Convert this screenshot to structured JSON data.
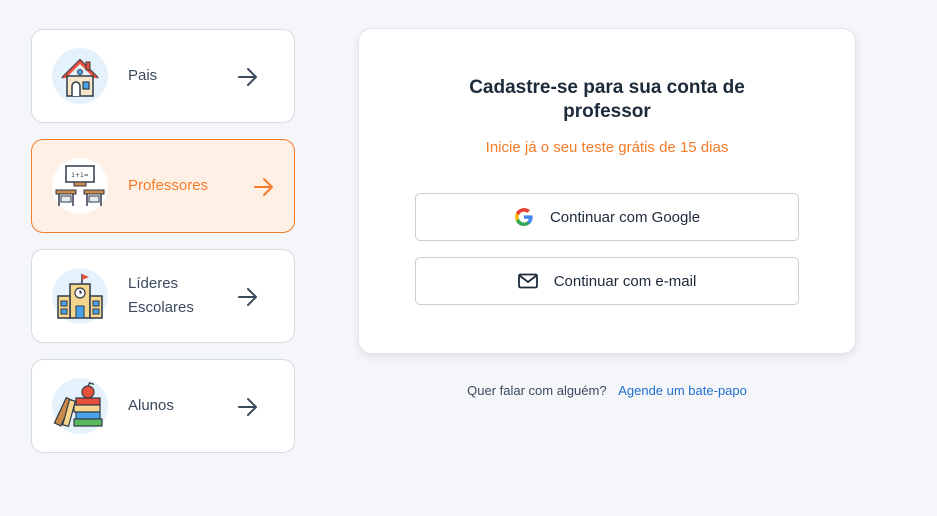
{
  "roles": [
    {
      "label": "Pais",
      "icon": "house-icon",
      "active": false
    },
    {
      "label": "Professores",
      "icon": "classroom-icon",
      "active": true
    },
    {
      "label": "Líderes Escolares",
      "icon": "school-building-icon",
      "active": false
    },
    {
      "label": "Alunos",
      "icon": "books-apple-icon",
      "active": false
    }
  ],
  "signup": {
    "title": "Cadastre-se para sua conta de professor",
    "subtitle": "Inicie já o seu teste grátis de 15 dias",
    "google_button": "Continuar com Google",
    "email_button": "Continuar com e-mail"
  },
  "footer": {
    "text": "Quer falar com alguém?",
    "link": "Agende um bate-papo"
  },
  "colors": {
    "accent": "#f47b2a",
    "link": "#1f6fd1",
    "text": "#1c2a3a",
    "background": "#f5f6fa"
  }
}
